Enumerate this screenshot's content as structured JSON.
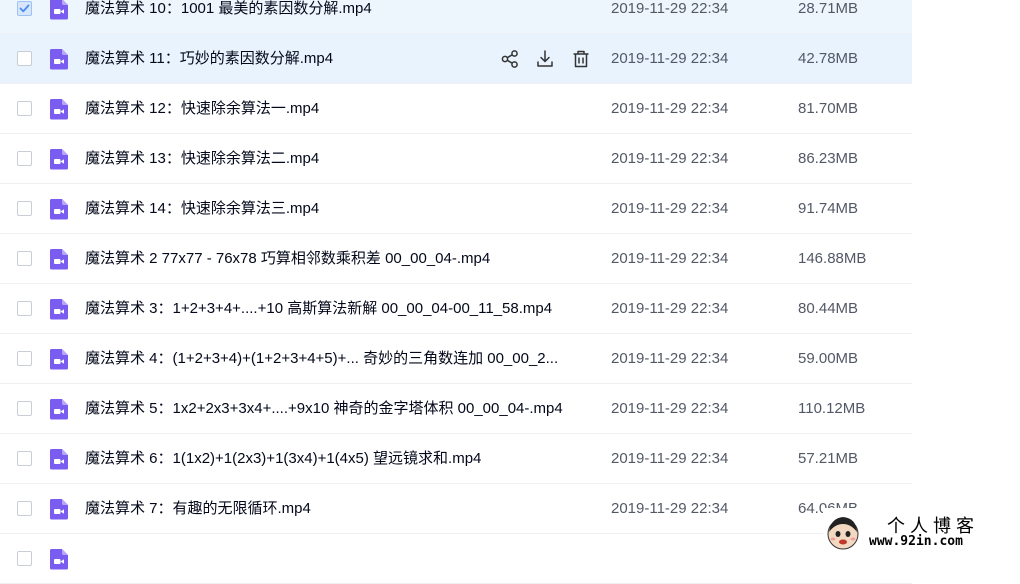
{
  "files": [
    {
      "name": "魔法算术 10：1001  最美的素因数分解.mp4",
      "date": "2019-11-29 22:34",
      "size": "28.71MB",
      "checked": true,
      "hover": false
    },
    {
      "name": "魔法算术 11：巧妙的素因数分解.mp4",
      "date": "2019-11-29 22:34",
      "size": "42.78MB",
      "checked": false,
      "hover": true
    },
    {
      "name": "魔法算术 12：快速除余算法一.mp4",
      "date": "2019-11-29 22:34",
      "size": "81.70MB",
      "checked": false,
      "hover": false
    },
    {
      "name": "魔法算术 13：快速除余算法二.mp4",
      "date": "2019-11-29 22:34",
      "size": "86.23MB",
      "checked": false,
      "hover": false
    },
    {
      "name": "魔法算术 14：快速除余算法三.mp4",
      "date": "2019-11-29 22:34",
      "size": "91.74MB",
      "checked": false,
      "hover": false
    },
    {
      "name": "魔法算术 2 77x77 - 76x78  巧算相邻数乘积差 00_00_04-.mp4",
      "date": "2019-11-29 22:34",
      "size": "146.88MB",
      "checked": false,
      "hover": false
    },
    {
      "name": "魔法算术 3：1+2+3+4+....+10  高斯算法新解 00_00_04-00_11_58.mp4",
      "date": "2019-11-29 22:34",
      "size": "80.44MB",
      "checked": false,
      "hover": false
    },
    {
      "name": "魔法算术 4：(1+2+3+4)+(1+2+3+4+5)+... 奇妙的三角数连加 00_00_2...",
      "date": "2019-11-29 22:34",
      "size": "59.00MB",
      "checked": false,
      "hover": false
    },
    {
      "name": "魔法算术 5：1x2+2x3+3x4+....+9x10  神奇的金字塔体积 00_00_04-.mp4",
      "date": "2019-11-29 22:34",
      "size": "110.12MB",
      "checked": false,
      "hover": false
    },
    {
      "name": "魔法算术 6：1(1x2)+1(2x3)+1(3x4)+1(4x5) 望远镜求和.mp4",
      "date": "2019-11-29 22:34",
      "size": "57.21MB",
      "checked": false,
      "hover": false
    },
    {
      "name": "魔法算术 7：有趣的无限循环.mp4",
      "date": "2019-11-29 22:34",
      "size": "64.06MB",
      "checked": false,
      "hover": false
    },
    {
      "name": "",
      "date": "",
      "size": "",
      "checked": false,
      "hover": false
    }
  ],
  "icons": {
    "file": "video-file-icon",
    "checkmark": "checkmark-icon",
    "share": "share-icon",
    "download": "download-icon",
    "delete": "trash-icon"
  },
  "colors": {
    "accent": "#7a5cf0",
    "check": "#4a8af4",
    "hover_row": "#e8f3fd",
    "selected_row": "#eef6fd"
  },
  "watermark": {
    "title": "个人博客",
    "url": "www.92in.com"
  }
}
